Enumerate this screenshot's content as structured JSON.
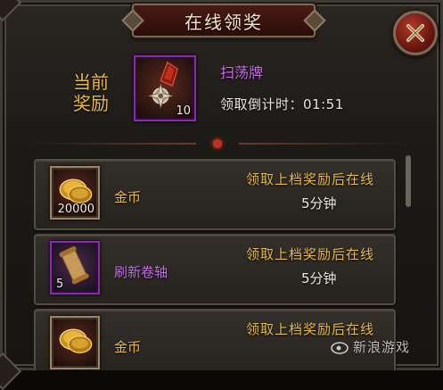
{
  "window": {
    "title": "在线领奖"
  },
  "current_reward": {
    "label_line1": "当前",
    "label_line2": "奖励",
    "item_name": "扫荡牌",
    "item_count": "10",
    "countdown_label": "领取倒计时：",
    "countdown_value": "01:51",
    "icon": "sweep-token-icon"
  },
  "rewards": [
    {
      "item_name": "金币",
      "count": "20000",
      "icon": "gold-coins-icon",
      "name_color": "#e6b84a",
      "condition": "领取上档奖励后在线",
      "duration": "5分钟"
    },
    {
      "item_name": "刷新卷轴",
      "count": "5",
      "icon": "scroll-icon",
      "name_color": "#c56ce6",
      "condition": "领取上档奖励后在线",
      "duration": "5分钟"
    },
    {
      "item_name": "金币",
      "count": "",
      "icon": "gold-coins-icon",
      "name_color": "#e6b84a",
      "condition": "领取上档奖励后在线",
      "duration": ""
    }
  ],
  "watermark": {
    "text": "新浪游戏",
    "brand": "sina"
  },
  "colors": {
    "gold_text": "#e6b84a",
    "purple_text": "#c56ce6",
    "rare_border": "#8a2aa8",
    "close_red": "#b03a2a"
  }
}
